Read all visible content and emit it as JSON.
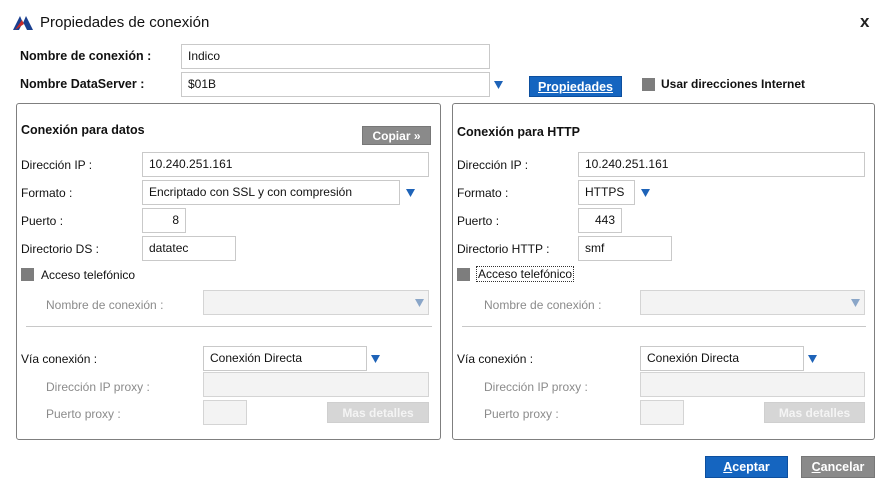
{
  "window": {
    "title": "Propiedades de conexión",
    "close_glyph": "x"
  },
  "header": {
    "connection_name_label": "Nombre de conexión :",
    "connection_name_value": "Indico",
    "dataserver_label": "Nombre DataServer :",
    "dataserver_value": "$01B",
    "properties_button": "Propiedades",
    "internet_checkbox_label": "Usar direcciones Internet"
  },
  "left_panel": {
    "title": "Conexión para datos",
    "copy_button": "Copiar »",
    "ip_label": "Dirección IP :",
    "ip_value": "10.240.251.161",
    "format_label": "Formato :",
    "format_value": "Encriptado con SSL y con compresión",
    "port_label": "Puerto :",
    "port_value": "8",
    "dir_label": "Directorio DS :",
    "dir_value": "datatec",
    "phone_label": "Acceso telefónico",
    "conn_name_label": "Nombre de conexión :",
    "via_label": "Vía conexión :",
    "via_value": "Conexión Directa",
    "proxy_ip_label": "Dirección IP proxy :",
    "proxy_port_label": "Puerto proxy :",
    "more_button": "Mas detalles"
  },
  "right_panel": {
    "title": "Conexión para HTTP",
    "ip_label": "Dirección IP :",
    "ip_value": "10.240.251.161",
    "format_label": "Formato :",
    "format_value": "HTTPS",
    "port_label": "Puerto :",
    "port_value": "443",
    "dir_label": "Directorio HTTP :",
    "dir_value": "smf",
    "phone_label": "Acceso telefónico",
    "conn_name_label": "Nombre de conexión :",
    "via_label": "Vía conexión :",
    "via_value": "Conexión Directa",
    "proxy_ip_label": "Dirección IP proxy :",
    "proxy_port_label": "Puerto proxy :",
    "more_button": "Mas detalles"
  },
  "footer": {
    "accept_rest": "ceptar",
    "accept_mnemonic": "A",
    "cancel_rest": "ancelar",
    "cancel_mnemonic": "C"
  },
  "colors": {
    "accent_blue": "#1565c0",
    "dropdown_arrow": "#1e63b8",
    "checkbox_gray": "#7d7d7d",
    "panel_border": "#7f7f7f"
  },
  "icons": {
    "app": "app-logo-icon",
    "close": "close-icon",
    "dropdown": "chevron-down-icon"
  }
}
